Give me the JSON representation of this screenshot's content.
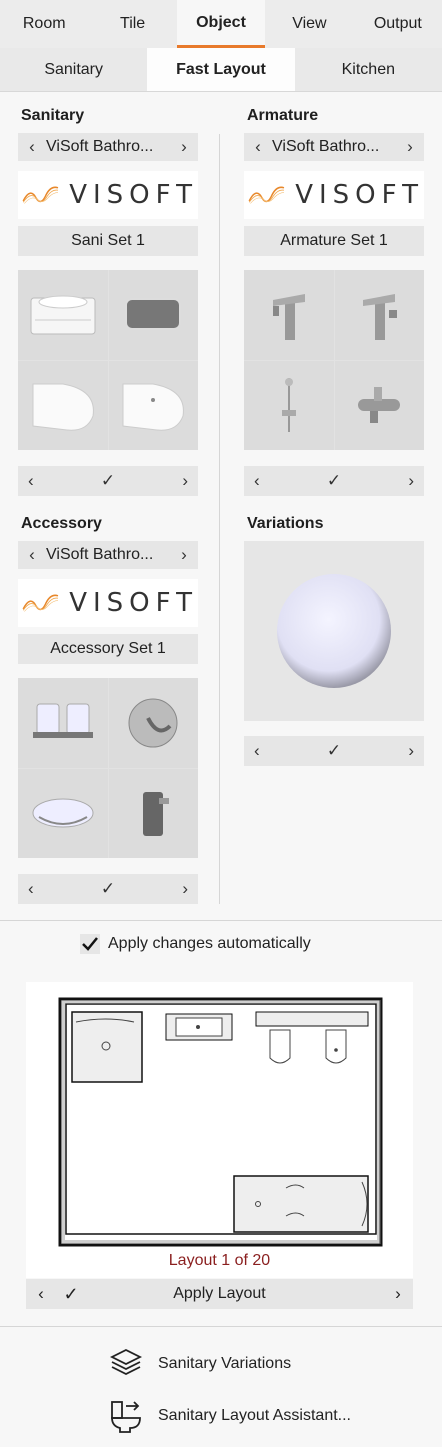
{
  "main_tabs": [
    {
      "label": "Room"
    },
    {
      "label": "Tile"
    },
    {
      "label": "Object"
    },
    {
      "label": "View"
    },
    {
      "label": "Output"
    }
  ],
  "sub_tabs": [
    {
      "label": "Sanitary"
    },
    {
      "label": "Fast Layout"
    },
    {
      "label": "Kitchen"
    }
  ],
  "sanitary": {
    "title": "Sanitary",
    "catalog": "ViSoft Bathro...",
    "logo_text": "VISOFT",
    "set_name": "Sani Set 1"
  },
  "armature": {
    "title": "Armature",
    "catalog": "ViSoft Bathro...",
    "logo_text": "VISOFT",
    "set_name": "Armature Set 1"
  },
  "accessory": {
    "title": "Accessory",
    "catalog": "ViSoft Bathro...",
    "logo_text": "VISOFT",
    "set_name": "Accessory Set 1"
  },
  "variations": {
    "title": "Variations"
  },
  "apply_auto": {
    "label": "Apply changes automatically",
    "checked": true
  },
  "layout": {
    "counter": "Layout 1 of 20",
    "apply_label": "Apply Layout"
  },
  "tools": [
    {
      "label": "Sanitary Variations",
      "icon": "layers-icon"
    },
    {
      "label": "Sanitary Layout Assistant...",
      "icon": "toilet-icon"
    }
  ],
  "colors": {
    "accent": "#e87a2b",
    "layout_counter": "#8a1f1f"
  }
}
